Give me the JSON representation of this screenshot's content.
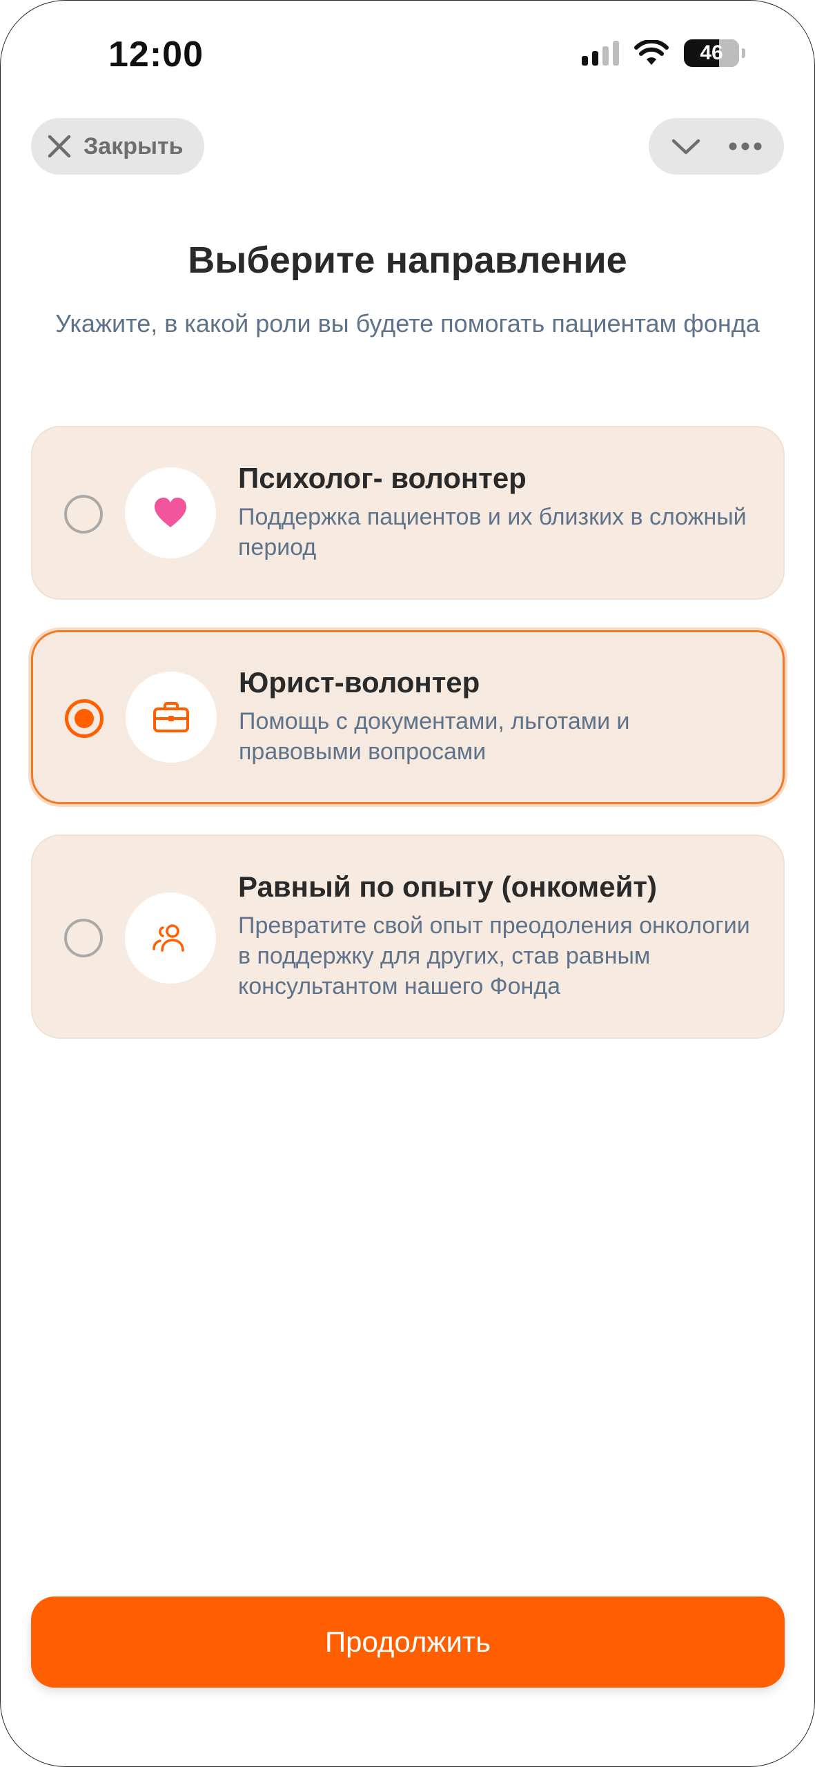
{
  "status_bar": {
    "time": "12:00",
    "battery_level": "46",
    "icons": [
      "cellular-signal-icon",
      "wifi-icon",
      "battery-icon"
    ]
  },
  "header": {
    "close_label": "Закрыть",
    "close_icon": "close-icon",
    "collapse_icon": "chevron-down-icon",
    "more_icon": "more-dots-icon"
  },
  "page": {
    "title": "Выберите направление",
    "subtitle": "Укажите, в какой роли вы будете помогать пациентам фонда"
  },
  "options": [
    {
      "title": "Психолог- волонтер",
      "description": "Поддержка пациентов и их близких в сложный период",
      "icon": "heart-icon",
      "icon_color": "#f2559b",
      "selected": false
    },
    {
      "title": "Юрист-волонтер",
      "description": "Помощь с документами, льготами и правовыми вопросами",
      "icon": "briefcase-icon",
      "icon_color": "#ff5f00",
      "selected": true
    },
    {
      "title": "Равный по опыту (онкомейт)",
      "description": "Превратите свой опыт преодоления онкологии в поддержку для других, став равным консультантом нашего Фонда",
      "icon": "users-icon",
      "icon_color": "#ff5f00",
      "selected": false
    }
  ],
  "footer": {
    "continue_label": "Продолжить"
  },
  "colors": {
    "accent": "#ff5f00",
    "card_background": "#f7ebe1",
    "text_primary": "#2a2a2a",
    "text_secondary": "#5e7389"
  }
}
